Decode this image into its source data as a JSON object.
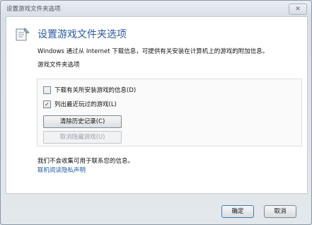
{
  "window": {
    "title": "设置游戏文件夹选项",
    "close_label": "✕"
  },
  "header": {
    "heading": "设置游戏文件夹选项"
  },
  "description": {
    "line1": "Windows 通过从 Internet 下载信息，可提供有关安装在计算机上的游戏的附加信息。",
    "line2": "游戏文件夹选项"
  },
  "options": {
    "download_info": {
      "label": "下载有关所安装游戏的信息(D)",
      "checked": false
    },
    "list_recent": {
      "label": "列出最近玩过的游戏(L)",
      "checked": true
    },
    "clear_history_label": "清除历史记录(C)",
    "unhide_games_label": "取消隐藏游戏(U)"
  },
  "privacy": {
    "text": "我们不会收集可用于联系您的信息。",
    "link": "联机阅读隐私声明"
  },
  "footer": {
    "ok_label": "确定",
    "cancel_label": "取消"
  }
}
